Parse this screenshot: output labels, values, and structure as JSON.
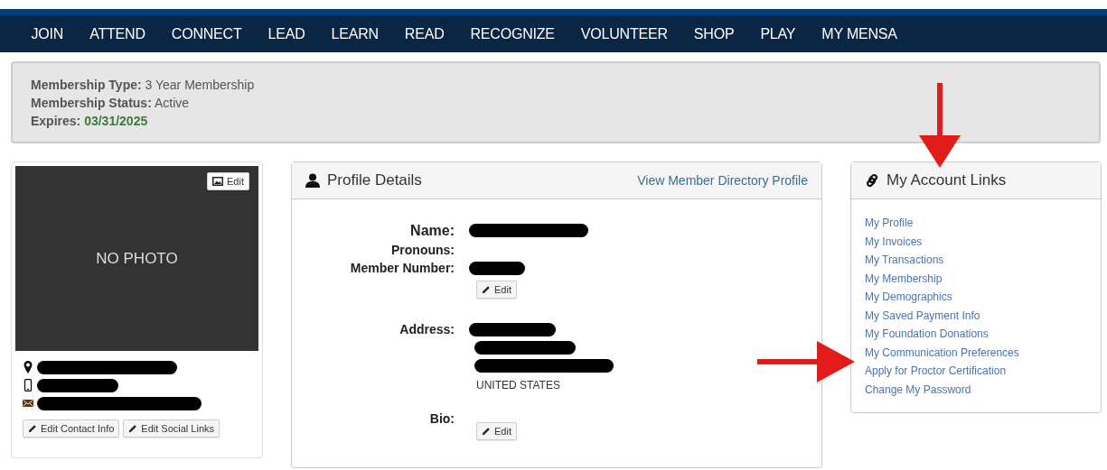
{
  "nav": {
    "items": [
      "JOIN",
      "ATTEND",
      "CONNECT",
      "LEAD",
      "LEARN",
      "READ",
      "RECOGNIZE",
      "VOLUNTEER",
      "SHOP",
      "PLAY",
      "MY MENSA"
    ]
  },
  "membership": {
    "rows": [
      {
        "label": "Membership Type:",
        "value": "3 Year Membership",
        "kind": "plain"
      },
      {
        "label": "Membership Status:",
        "value": "Active",
        "kind": "plain"
      },
      {
        "label": "Expires:",
        "value": "03/31/2025",
        "kind": "date"
      }
    ]
  },
  "photo_card": {
    "photo_text": "NO PHOTO",
    "photo_edit": "Edit",
    "contacts": [
      {
        "kind": "location",
        "redacted": true
      },
      {
        "kind": "phone",
        "redacted": true
      },
      {
        "kind": "email",
        "redacted": true
      }
    ],
    "buttons": [
      "Edit Contact Info",
      "Edit Social Links"
    ]
  },
  "profile": {
    "title": "Profile Details",
    "directory_link": "View Member Directory Profile",
    "fields": [
      {
        "label": "Name:",
        "prominent": true,
        "values": [
          {
            "kind": "redacted"
          }
        ]
      },
      {
        "label": "Pronouns:",
        "prominent": false
      },
      {
        "label": "Member Number:",
        "prominent": false,
        "values": [
          {
            "kind": "redacted"
          }
        ],
        "edit_button": "Edit"
      },
      {
        "label": "Address:",
        "prominent": false,
        "values": [
          {
            "kind": "redacted"
          },
          {
            "kind": "redacted"
          },
          {
            "kind": "redacted"
          },
          {
            "kind": "text",
            "text": "UNITED STATES"
          }
        ]
      },
      {
        "label": "Bio:",
        "prominent": false,
        "edit_button": "Edit"
      }
    ]
  },
  "account_links": {
    "title": "My Account Links",
    "links": [
      "My Profile",
      "My Invoices",
      "My Transactions",
      "My Membership",
      "My Demographics",
      "My Saved Payment Info",
      "My Foundation Donations",
      "My Communication Preferences",
      "Apply for Proctor Certification",
      "Change My Password"
    ]
  },
  "annotations": [
    {
      "kind": "arrow-down"
    },
    {
      "kind": "arrow-right"
    }
  ]
}
